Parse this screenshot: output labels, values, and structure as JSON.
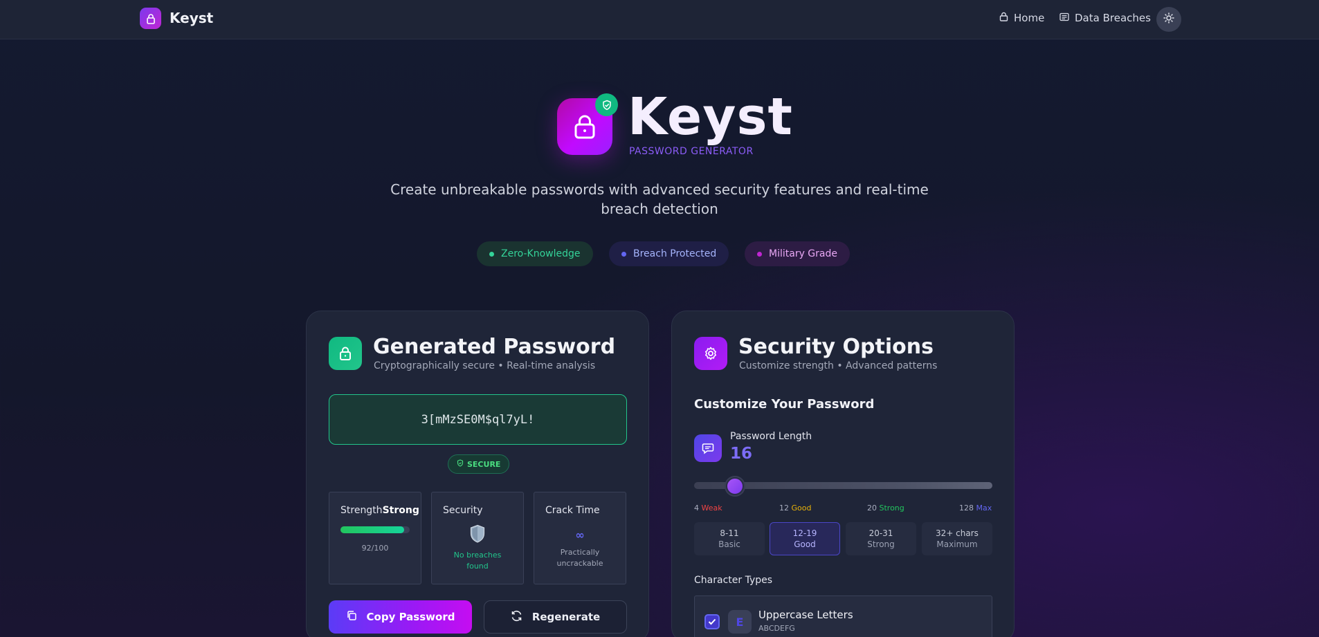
{
  "nav": {
    "brand": "Keyst",
    "links": [
      {
        "label": "Home",
        "icon": "lock-icon"
      },
      {
        "label": "Data Breaches",
        "icon": "newspaper-icon"
      }
    ],
    "theme_icon": "sun-icon"
  },
  "hero": {
    "title": "Keyst",
    "subtitle": "PASSWORD GENERATOR",
    "description": "Create unbreakable passwords with advanced security features and real-time breach detection",
    "pills": [
      {
        "label": "Zero-Knowledge",
        "color": "#34d399"
      },
      {
        "label": "Breach Protected",
        "color": "#6366f1"
      },
      {
        "label": "Military Grade",
        "color": "#c026d3"
      }
    ]
  },
  "generator": {
    "title": "Generated Password",
    "subtitle": "Cryptographically secure • Real-time analysis",
    "password": "3[mMzSE0M$ql7yL!",
    "badge": "SECURE",
    "strength": {
      "label": "Strength",
      "value_label": "Strong",
      "score": "92/100",
      "fill_fraction": 0.92
    },
    "security": {
      "label": "Security",
      "icon": "shield-icon",
      "status": "No breaches found"
    },
    "crack": {
      "label": "Crack Time",
      "value": "∞",
      "status": "Practically uncrackable"
    },
    "copy_label": "Copy Password",
    "regen_label": "Regenerate"
  },
  "options": {
    "title": "Security Options",
    "subtitle": "Customize strength • Advanced patterns",
    "section_title": "Customize Your Password",
    "length_label": "Password Length",
    "length_value": "16",
    "slider": {
      "min": 4,
      "max": 128,
      "value": 16
    },
    "ticks": [
      {
        "num": "4",
        "word": "Weak",
        "color": "#ef4444"
      },
      {
        "num": "12",
        "word": "Good",
        "color": "#eab308"
      },
      {
        "num": "20",
        "word": "Strong",
        "color": "#22c55e"
      },
      {
        "num": "128",
        "word": "Max",
        "color": "#6366f1"
      }
    ],
    "ranges": [
      {
        "range": "8-11",
        "label": "Basic",
        "active": false
      },
      {
        "range": "12-19",
        "label": "Good",
        "active": true
      },
      {
        "range": "20-31",
        "label": "Strong",
        "active": false
      },
      {
        "range": "32+ chars",
        "label": "Maximum",
        "active": false
      }
    ],
    "char_types_title": "Character Types",
    "char_types": [
      {
        "letter": "E",
        "name": "Uppercase Letters",
        "sample": "ABCDEFG",
        "checked": true
      }
    ]
  }
}
